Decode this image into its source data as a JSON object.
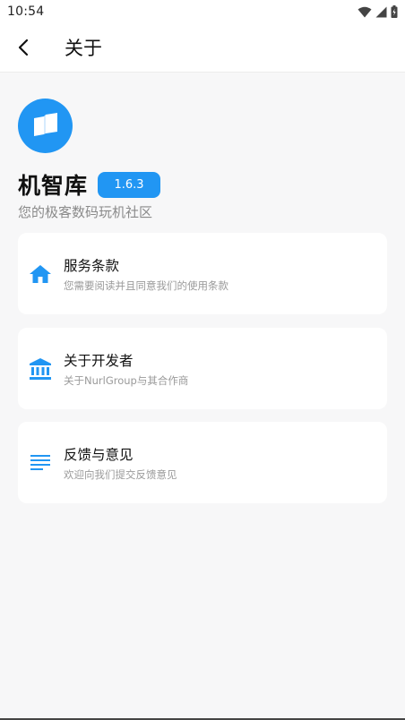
{
  "status_bar": {
    "time": "10:54"
  },
  "app_bar": {
    "title": "关于"
  },
  "app_info": {
    "name": "机智库",
    "version": "1.6.3",
    "slogan": "您的极客数码玩机社区"
  },
  "menu": {
    "items": [
      {
        "title": "服务条款",
        "subtitle": "您需要阅读并且同意我们的使用条款",
        "icon": "home-icon"
      },
      {
        "title": "关于开发者",
        "subtitle": "关于NurlGroup与其合作商",
        "icon": "bank-icon"
      },
      {
        "title": "反馈与意见",
        "subtitle": "欢迎向我们提交反馈意见",
        "icon": "notes-icon"
      }
    ]
  },
  "colors": {
    "accent": "#2196f3",
    "background": "#f7f7f8",
    "card": "#ffffff"
  }
}
